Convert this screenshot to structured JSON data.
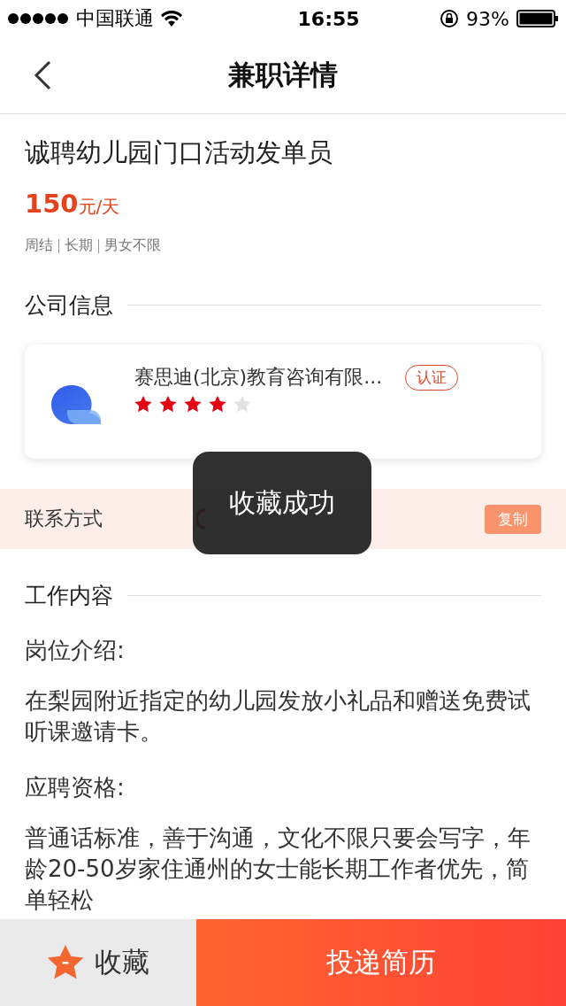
{
  "status_bar": {
    "carrier": "中国联通",
    "time": "16:55",
    "battery": "93%"
  },
  "nav": {
    "title": "兼职详情"
  },
  "job": {
    "title": "诚聘幼儿园门口活动发单员",
    "salary": "150",
    "salary_unit": "元/天",
    "tags": [
      "周结",
      "长期",
      "男女不限"
    ]
  },
  "company_section": {
    "heading": "公司信息"
  },
  "company": {
    "name": "赛思迪(北京)教育咨询有限...",
    "badge": "认证",
    "stars": 4
  },
  "contact": {
    "label": "联系方式",
    "copy_button": "复制"
  },
  "toast": {
    "text": "收藏成功"
  },
  "content_section": {
    "heading": "工作内容",
    "paragraphs": [
      {
        "kind": "label",
        "text": "岗位介绍:"
      },
      {
        "kind": "body",
        "text": "在梨园附近指定的幼儿园发放小礼品和赠送免费试听课邀请卡。"
      },
      {
        "kind": "label",
        "text": "应聘资格:"
      },
      {
        "kind": "body",
        "text": "普通话标准，善于沟通，文化不限只要会写字，年龄20-50岁家住通州的女士能长期工作者优先，简单轻松"
      }
    ]
  },
  "bottom_bar": {
    "favorite": "收藏",
    "apply": "投递简历"
  }
}
